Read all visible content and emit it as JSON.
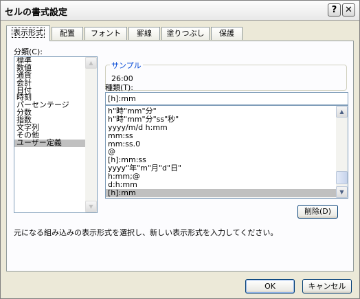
{
  "window": {
    "title": "セルの書式設定",
    "help_label": "?",
    "close_label": "✕"
  },
  "tabs": [
    "表示形式",
    "配置",
    "フォント",
    "罫線",
    "塗りつぶし",
    "保護"
  ],
  "category": {
    "label": "分類(C):",
    "items": [
      "標準",
      "数値",
      "通貨",
      "会計",
      "日付",
      "時刻",
      "パーセンテージ",
      "分数",
      "指数",
      "文字列",
      "その他",
      "ユーザー定義"
    ],
    "selected_index": 11
  },
  "sample": {
    "label": "サンプル",
    "value": "26:00"
  },
  "type_field": {
    "label": "種類(T):",
    "value": "[h]:mm"
  },
  "formats": {
    "items": [
      "h\"時\"mm\"分\"",
      "h\"時\"mm\"分\"ss\"秒\"",
      "yyyy/m/d h:mm",
      "mm:ss",
      "mm:ss.0",
      "@",
      "[h]:mm:ss",
      "yyyy\"年\"m\"月\"d\"日\"",
      "h:mm;@",
      "d:h:mm",
      "[h]:mm"
    ],
    "selected_index": 10
  },
  "delete_button": "削除(D)",
  "description": "元になる組み込みの表示形式を選択し、新しい表示形式を入力してください。",
  "ok_button": "OK",
  "cancel_button": "キャンセル",
  "icons": {
    "scroll_up": "▲",
    "scroll_down": "▼"
  }
}
